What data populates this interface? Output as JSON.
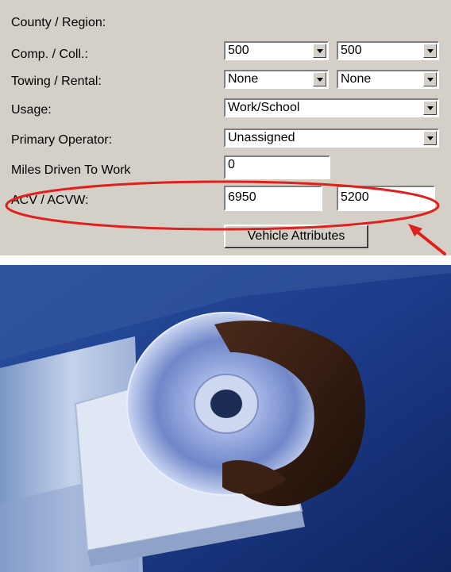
{
  "form": {
    "labels": {
      "county": "County / Region:",
      "comp_coll": "Comp. / Coll.:",
      "towing_rental": "Towing / Rental:",
      "usage": "Usage:",
      "primary_operator": "Primary Operator:",
      "miles": "Miles Driven To Work",
      "acv": "ACV / ACVW:"
    },
    "comp_value": "500",
    "coll_value": "500",
    "towing_value": "None",
    "rental_value": "None",
    "usage_value": "Work/School",
    "operator_value": "Unassigned",
    "miles_value": "0",
    "acv_value": "6950",
    "acvw_value": "5200",
    "vehicle_attributes_label": "Vehicle Attributes"
  },
  "highlight": {
    "color": "#e0201c"
  },
  "photo": {
    "description_icon": "cd-drive-icon"
  }
}
